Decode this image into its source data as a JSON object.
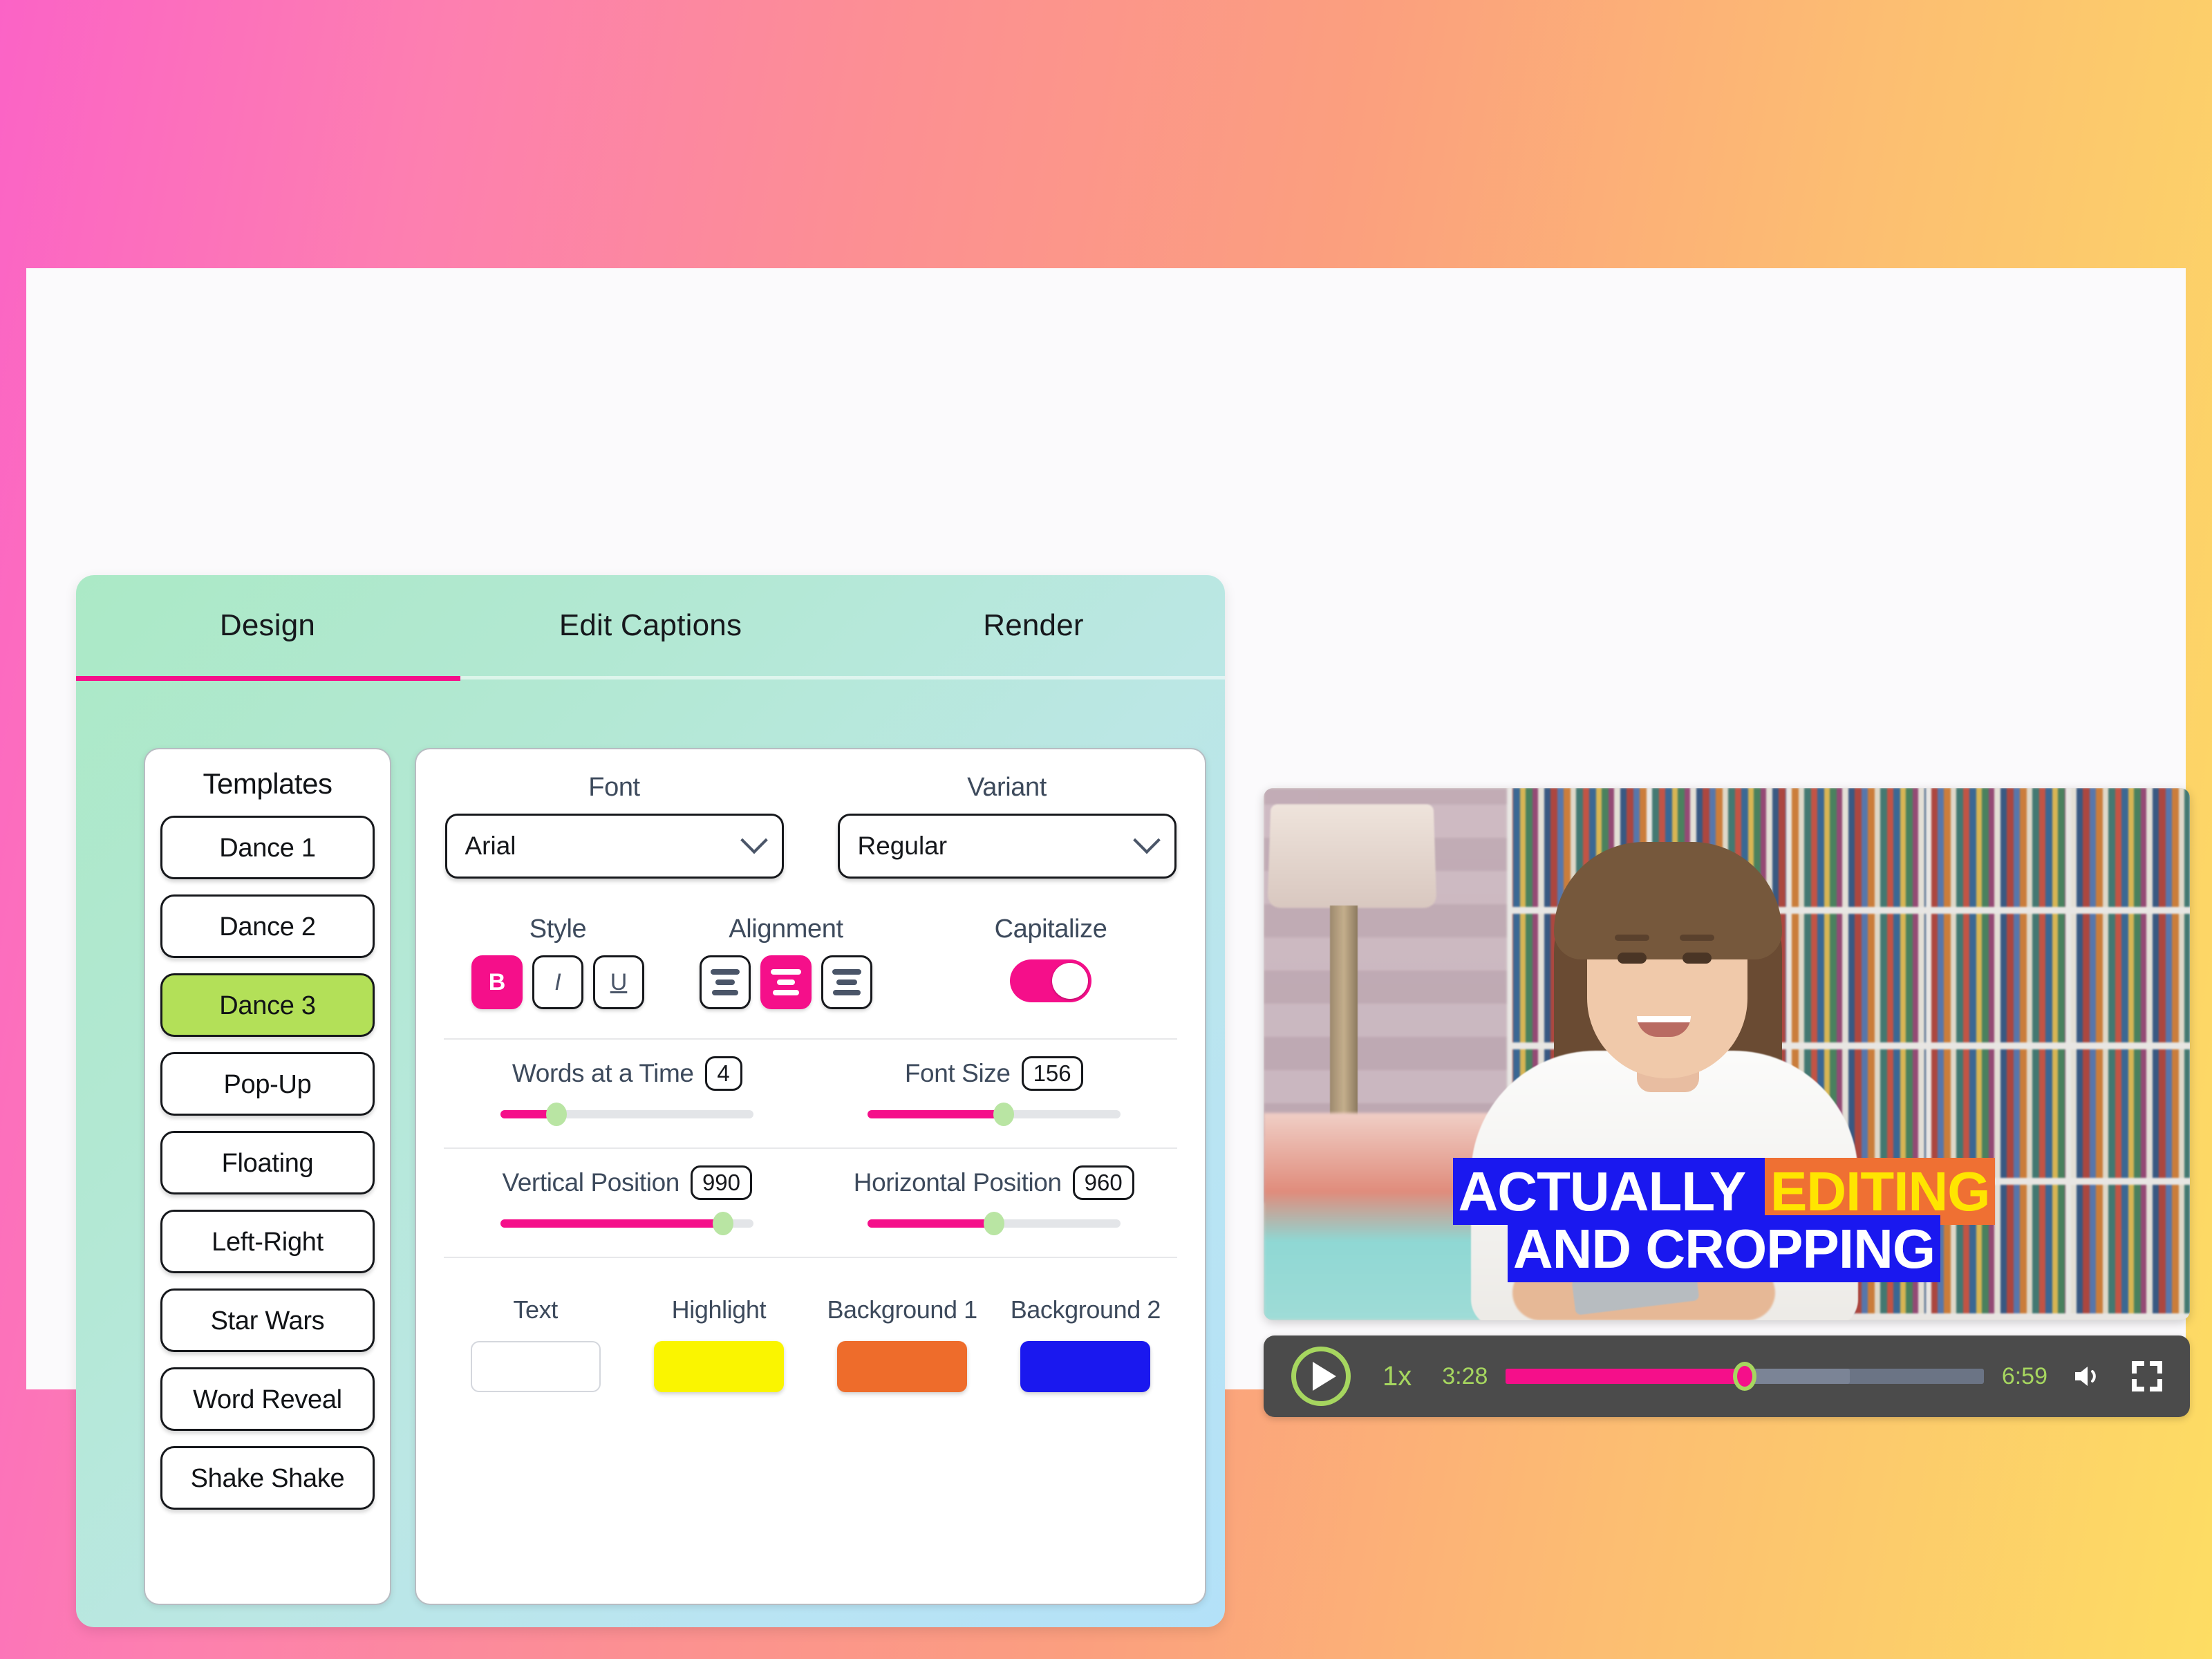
{
  "background": {
    "gradient_from": "#fb63c6",
    "gradient_mid": "#fb9f7e",
    "gradient_to": "#fddd63"
  },
  "panel": {
    "gradient_from": "#abe9c6",
    "gradient_to": "#b3e1f8",
    "accent": "#f50f8a"
  },
  "tabs": [
    {
      "label": "Design",
      "active": true
    },
    {
      "label": "Edit Captions",
      "active": false
    },
    {
      "label": "Render",
      "active": false
    }
  ],
  "templates": {
    "title": "Templates",
    "items": [
      {
        "label": "Dance 1",
        "active": false
      },
      {
        "label": "Dance 2",
        "active": false
      },
      {
        "label": "Dance 3",
        "active": true
      },
      {
        "label": "Pop-Up",
        "active": false
      },
      {
        "label": "Floating",
        "active": false
      },
      {
        "label": "Left-Right",
        "active": false
      },
      {
        "label": "Star Wars",
        "active": false
      },
      {
        "label": "Word Reveal",
        "active": false
      },
      {
        "label": "Shake Shake",
        "active": false
      }
    ],
    "active_color": "#b3e058"
  },
  "settings": {
    "font": {
      "label": "Font",
      "value": "Arial"
    },
    "variant": {
      "label": "Variant",
      "value": "Regular"
    },
    "style": {
      "label": "Style",
      "buttons": [
        {
          "label": "B",
          "name": "bold",
          "active": true
        },
        {
          "label": "I",
          "name": "italic",
          "active": false
        },
        {
          "label": "U",
          "name": "underline",
          "active": false
        }
      ]
    },
    "alignment": {
      "label": "Alignment",
      "buttons": [
        {
          "name": "align-left",
          "active": false
        },
        {
          "name": "align-center",
          "active": true
        },
        {
          "name": "align-right",
          "active": false
        }
      ]
    },
    "capitalize": {
      "label": "Capitalize",
      "on": true
    },
    "sliders": [
      {
        "label": "Words at a Time",
        "value": "4",
        "percent": 22
      },
      {
        "label": "Font Size",
        "value": "156",
        "percent": 54
      },
      {
        "label": "Vertical Position",
        "value": "990",
        "percent": 88
      },
      {
        "label": "Horizontal Position",
        "value": "960",
        "percent": 50
      }
    ],
    "colors": [
      {
        "label": "Text",
        "value": "#ffffff",
        "empty": true
      },
      {
        "label": "Highlight",
        "value": "#faf500",
        "empty": false
      },
      {
        "label": "Background 1",
        "value": "#ee6c2b",
        "empty": false
      },
      {
        "label": "Background 2",
        "value": "#1a18ef",
        "empty": false
      }
    ]
  },
  "preview": {
    "caption": {
      "line1": [
        {
          "text": "ACTUALLY ",
          "style": "plain"
        },
        {
          "text": "EDITING",
          "style": "highlight"
        }
      ],
      "line2": [
        {
          "text": "AND CROPPING",
          "style": "plain"
        }
      ]
    },
    "player": {
      "play_label": "play",
      "speed": "1x",
      "current_time": "3:28",
      "total_time": "6:59",
      "progress_percent": 50,
      "buffer_percent": 72,
      "volume_icon": "volume-icon",
      "fullscreen_icon": "fullscreen-icon",
      "accent": "#a6d65f",
      "progress_color": "#f50f8a"
    }
  }
}
